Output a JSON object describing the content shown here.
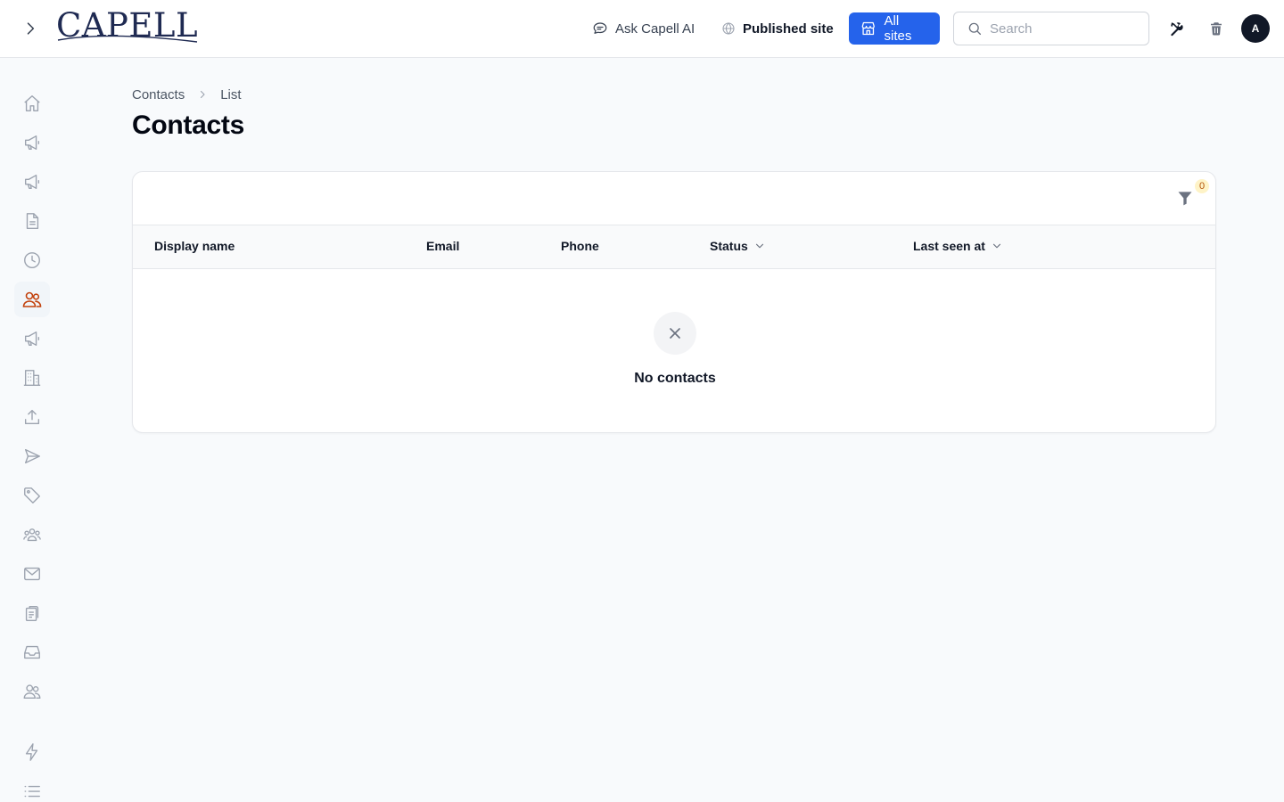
{
  "app": {
    "logo_text": "CAPELL",
    "brand_color": "#1f2a52",
    "accent_color": "#2563eb",
    "active_color": "#c2410c"
  },
  "topbar": {
    "ask_ai_label": "Ask Capell AI",
    "ask_ai_icon": "chat-bubble-icon",
    "published_label": "Published site",
    "published_icon": "globe-icon",
    "all_sites_label": "All sites",
    "all_sites_icon": "storefront-icon",
    "search_placeholder": "Search",
    "search_value": "",
    "avatar_initial": "A"
  },
  "sidebar": {
    "items": [
      {
        "icon": "home-icon",
        "active": false
      },
      {
        "icon": "megaphone-icon",
        "active": false
      },
      {
        "icon": "megaphone-icon",
        "active": false
      },
      {
        "icon": "document-icon",
        "active": false
      },
      {
        "icon": "clock-icon",
        "active": false
      },
      {
        "icon": "users-icon",
        "active": true
      },
      {
        "icon": "megaphone-icon",
        "active": false
      },
      {
        "icon": "building-icon",
        "active": false
      },
      {
        "icon": "upload-icon",
        "active": false
      },
      {
        "icon": "paper-plane-icon",
        "active": false
      },
      {
        "icon": "tag-icon",
        "active": false
      },
      {
        "icon": "user-group-icon",
        "active": false
      },
      {
        "icon": "envelope-icon",
        "active": false
      },
      {
        "icon": "clipboard-icon",
        "active": false
      },
      {
        "icon": "inbox-icon",
        "active": false
      },
      {
        "icon": "users-icon",
        "active": false
      },
      {
        "icon": "bolt-icon",
        "active": false
      },
      {
        "icon": "list-icon",
        "active": false
      }
    ]
  },
  "breadcrumb": {
    "items": [
      "Contacts",
      "List"
    ]
  },
  "page": {
    "title": "Contacts"
  },
  "table": {
    "filter_count": "0",
    "columns": [
      {
        "label": "Display name",
        "sortable": false
      },
      {
        "label": "Email",
        "sortable": false
      },
      {
        "label": "Phone",
        "sortable": false
      },
      {
        "label": "Status",
        "sortable": true
      },
      {
        "label": "Last seen at",
        "sortable": true
      }
    ],
    "rows": [],
    "empty_text": "No contacts"
  }
}
